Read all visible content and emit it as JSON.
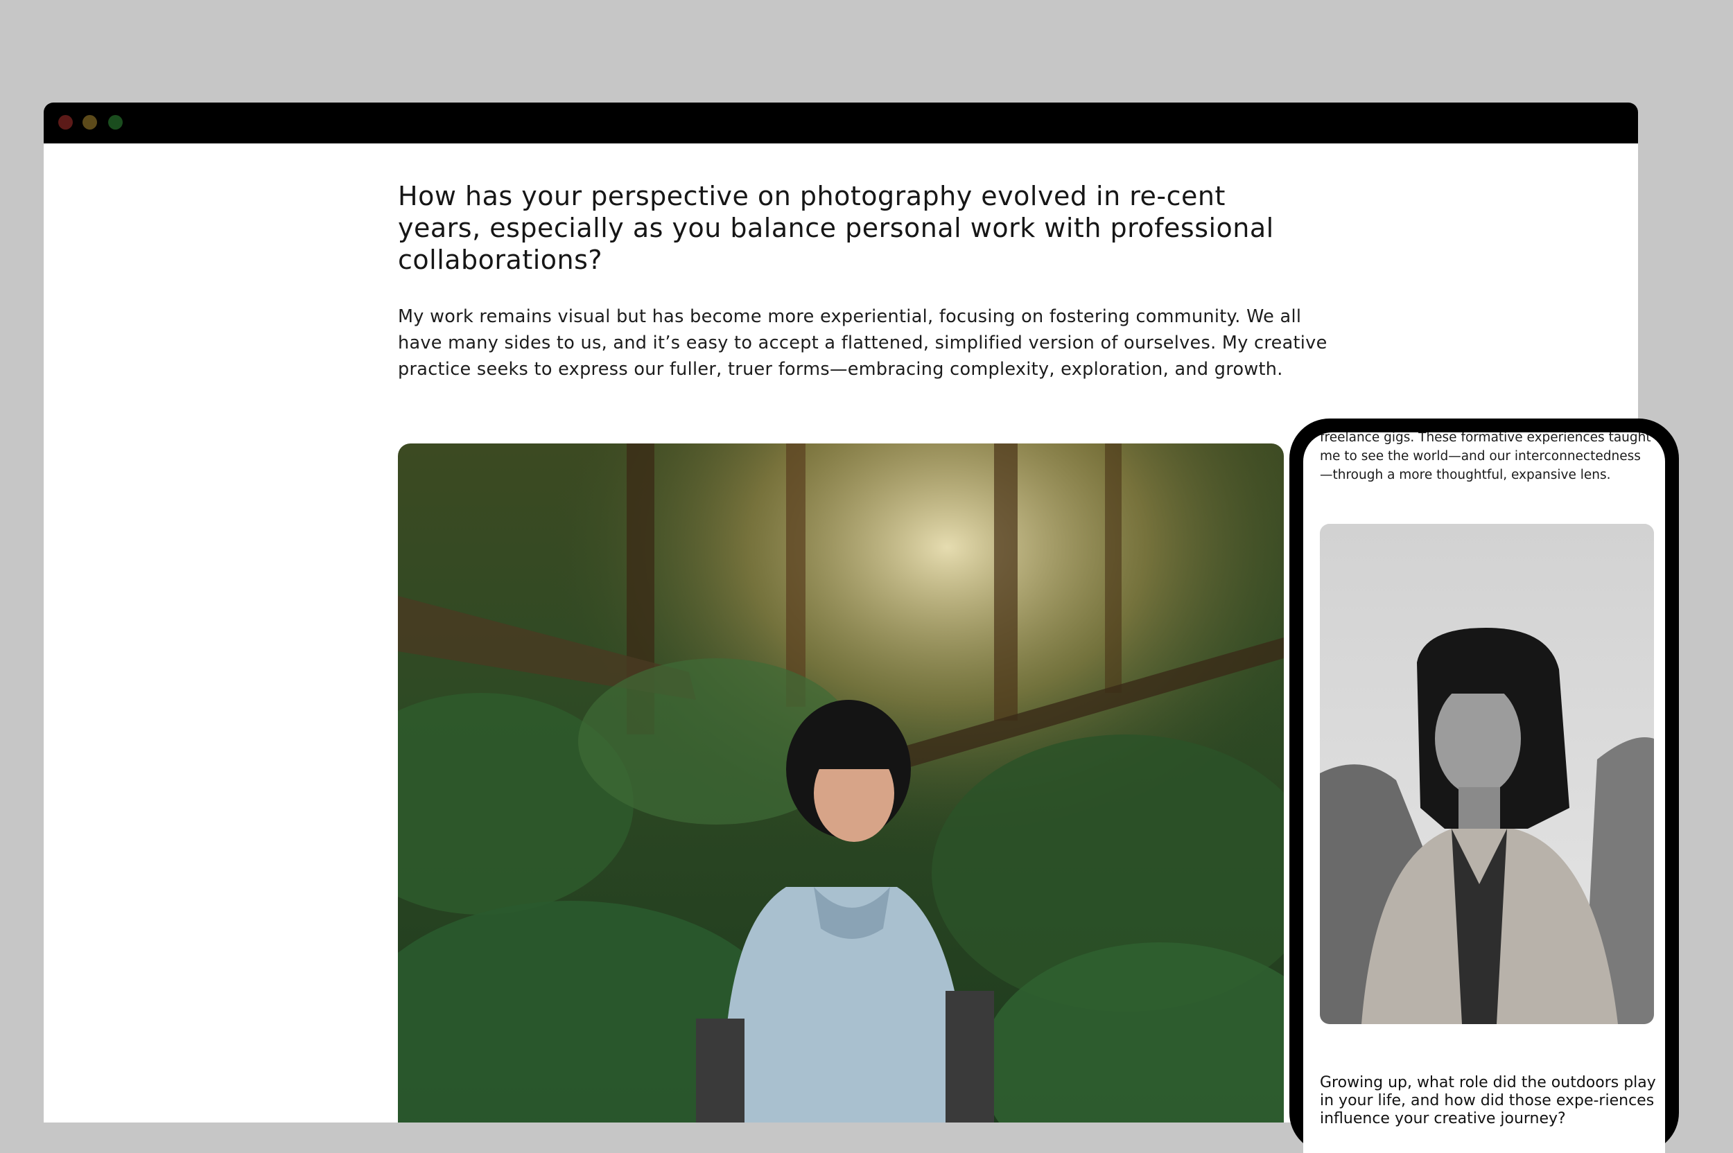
{
  "window": {
    "controls": [
      "close",
      "minimize",
      "maximize"
    ]
  },
  "article": {
    "question": "How has your perspective on photography evolved in re-cent years, especially as you balance personal work with professional collaborations?",
    "answer": "My work remains visual but has become more experiential, focusing on fostering community. We all have many sides to us, and it’s easy to accept a flattened, simplified version of ourselves. My creative practice seeks to express our fuller, truer forms—embracing complexity, exploration, and growth.",
    "photo": "forest-portrait"
  },
  "phone": {
    "text_top": "freelance gigs. These formative experiences taught me to see the world—and our interconnectedness—through a more thoughtful, expansive lens.",
    "photo": "black-and-white-portrait",
    "question": "Growing up, what role did the outdoors play in your life, and how did those expe-riences influence your creative journey?"
  },
  "colors": {
    "background": "#c6c6c6",
    "titlebar": "#000000",
    "close": "#5c1a18",
    "minimize": "#5c4a1a",
    "maximize": "#1a4d1e"
  }
}
